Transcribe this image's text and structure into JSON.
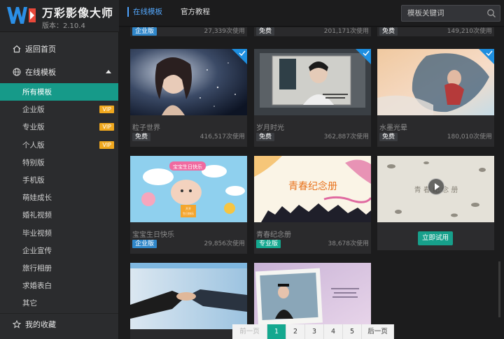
{
  "app": {
    "name": "万彩影像大师",
    "version": "版本：2.10.4"
  },
  "sidebar": {
    "home": "返回首页",
    "online": "在线模板",
    "favorites": "我的收藏",
    "items": [
      {
        "label": "所有模板",
        "vip": ""
      },
      {
        "label": "企业版",
        "vip": "VIP"
      },
      {
        "label": "专业版",
        "vip": "VIP"
      },
      {
        "label": "个人版",
        "vip": "VIP"
      },
      {
        "label": "特别版",
        "vip": ""
      },
      {
        "label": "手机版",
        "vip": ""
      },
      {
        "label": "萌娃成长",
        "vip": ""
      },
      {
        "label": "婚礼视频",
        "vip": ""
      },
      {
        "label": "毕业视频",
        "vip": ""
      },
      {
        "label": "企业宣传",
        "vip": ""
      },
      {
        "label": "旅行相册",
        "vip": ""
      },
      {
        "label": "求婚表白",
        "vip": ""
      },
      {
        "label": "其它",
        "vip": ""
      }
    ]
  },
  "topbar": {
    "tab_online": "在线模板",
    "tab_tutorial": "官方教程",
    "search_placeholder": "模板关键词"
  },
  "top_strip": [
    {
      "badge": "企业版",
      "usage": "27,339次使用"
    },
    {
      "badge": "免费",
      "usage": "201,171次使用"
    },
    {
      "badge": "免费",
      "usage": "149,210次使用"
    }
  ],
  "cards": [
    {
      "title": "粒子世界",
      "badge": "免费",
      "usage": "416,517次使用"
    },
    {
      "title": "岁月时光",
      "badge": "免费",
      "usage": "362,887次使用"
    },
    {
      "title": "水墨光晕",
      "badge": "免费",
      "usage": "180,010次使用"
    },
    {
      "title": "宝宝生日快乐",
      "badge": "企业版",
      "usage": "29,856次使用",
      "thumb_text": "宝宝生日快乐",
      "thumb_sign1": "开开",
      "thumb_sign2": "生日快乐"
    },
    {
      "title": "青春纪念册",
      "badge": "专业版",
      "usage": "38,678次使用",
      "thumb_text": "青春纪念册"
    },
    {
      "thumb_text": "青 春 纪 念 册",
      "try_label": "立即试用"
    }
  ],
  "pager": {
    "prev": "前一页",
    "pages": [
      "1",
      "2",
      "3",
      "4",
      "5"
    ],
    "next": "后一页",
    "current": "1"
  }
}
